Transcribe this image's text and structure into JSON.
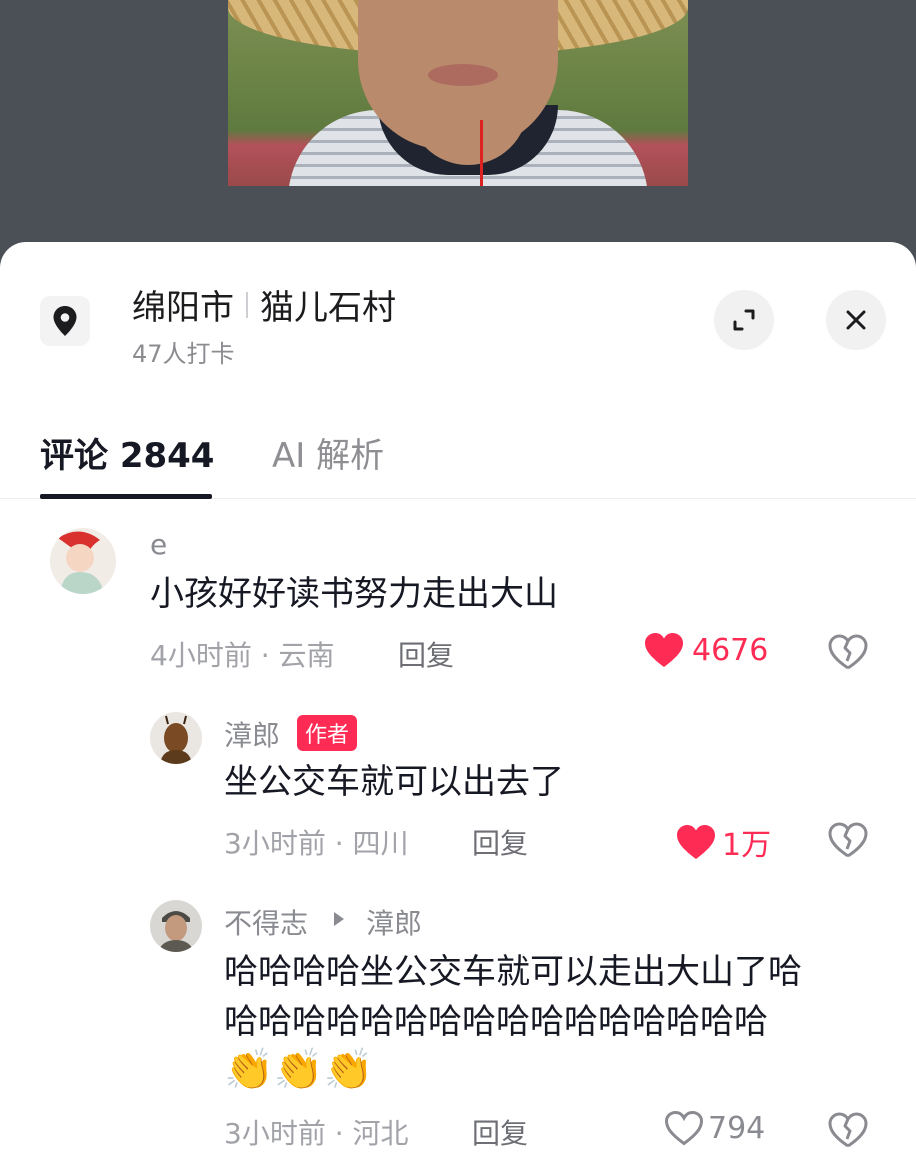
{
  "location": {
    "city": "绵阳市",
    "village": "猫儿石村",
    "checkins": "47人打卡"
  },
  "tabs": [
    {
      "label": "评论 2844",
      "active": true
    },
    {
      "label": "AI 解析",
      "active": false
    }
  ],
  "comments": [
    {
      "user": "e",
      "text": "小孩好好读书努力走出大山",
      "meta": "4小时前 · 云南",
      "reply_label": "回复",
      "likes": "4676",
      "liked": true
    },
    {
      "user": "漳郎",
      "badge": "作者",
      "text": "坐公交车就可以出去了",
      "meta": "3小时前 · 四川",
      "reply_label": "回复",
      "likes": "1万",
      "liked": true
    },
    {
      "user": "不得志",
      "reply_to": "漳郎",
      "text_line1": "哈哈哈哈坐公交车就可以走出大山了哈",
      "text_line2": "哈哈哈哈哈哈哈哈哈哈哈哈哈哈哈哈",
      "emojis": "👏👏👏",
      "meta": "3小时前 · 河北",
      "reply_label": "回复",
      "likes": "794",
      "liked": false
    }
  ],
  "colors": {
    "like_red": "#fe2c55",
    "text_primary": "#161823",
    "text_secondary": "#8a8b91"
  }
}
